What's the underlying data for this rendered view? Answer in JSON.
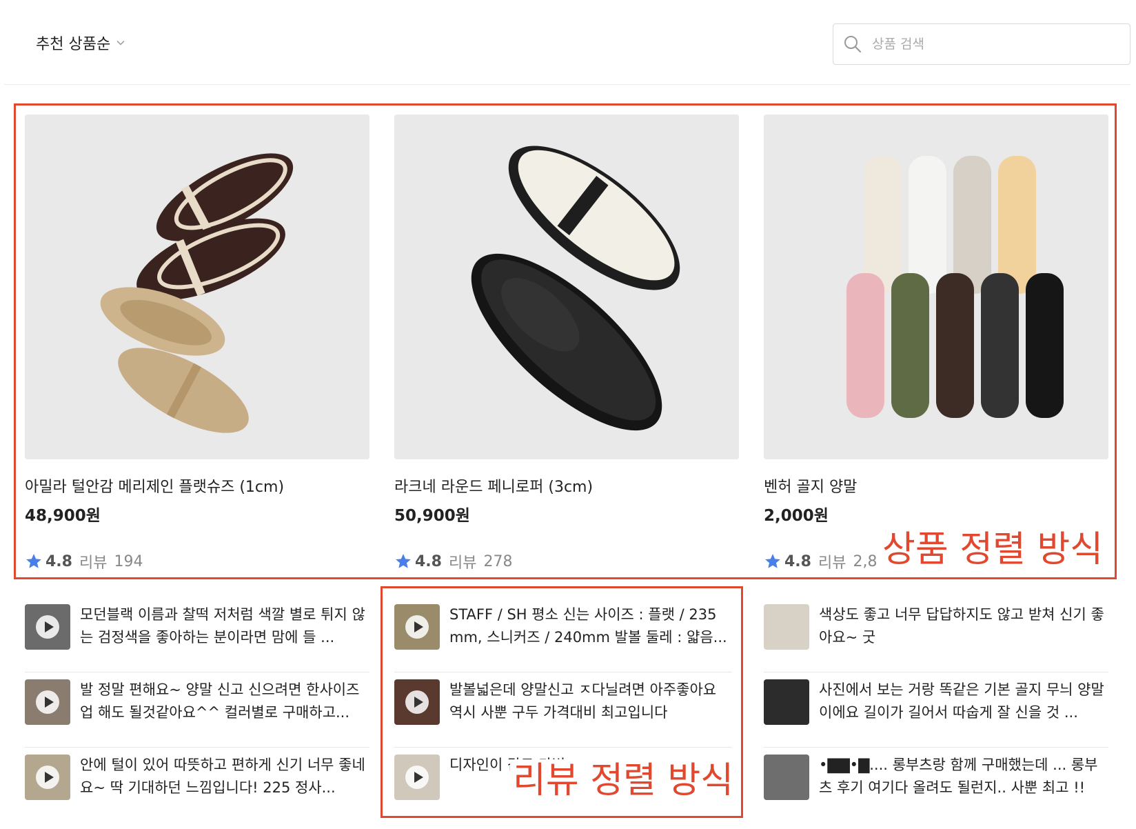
{
  "header": {
    "sort_label": "추천 상품순",
    "search_placeholder": "상품 검색"
  },
  "products": [
    {
      "name": "아밀라 털안감 메리제인 플랫슈즈 (1cm)",
      "price": "48,900원",
      "rating": "4.8",
      "review_label": "리뷰",
      "review_count": "194"
    },
    {
      "name": "라크네 라운드 페니로퍼 (3cm)",
      "price": "50,900원",
      "rating": "4.8",
      "review_label": "리뷰",
      "review_count": "278"
    },
    {
      "name": "벤허 골지 양말",
      "price": "2,000원",
      "rating": "4.8",
      "review_label": "리뷰",
      "review_count": "2,8"
    }
  ],
  "reviews": [
    [
      {
        "text": "모던블랙 이름과 찰떡 저처럼 색깔 별로 튀지 않는 검정색을 좋아하는 분이라면 맘에 들 ..."
      },
      {
        "text": "발 정말 편해요~ 양말 신고 신으려면 한사이즈 업 해도 될것같아요^^ 컬러별로 구매하고..."
      },
      {
        "text": "안에 털이 있어 따뜻하고 편하게 신기 너무 좋네요~ 딱 기대하던 느낌입니다! 225 정사..."
      }
    ],
    [
      {
        "text": "STAFF / SH 평소 신는 사이즈 : 플랫 / 235 mm, 스니커즈 / 240mm 발볼 둘레 : 얇음..."
      },
      {
        "text": "발볼넓은데 양말신고 ㅈ다닐려면 아주좋아요 역시 사뿐 구두 가격대비 최고입니다"
      },
      {
        "text": "디자인이 감도 가볍"
      }
    ],
    [
      {
        "text": "색상도 좋고 너무 답답하지도 않고 받쳐 신기 좋아요~ 굿"
      },
      {
        "text": "사진에서 보는 거랑 똑같은 기본 골지 무늬 양말이에요 길이가 길어서 따숩게 잘 신을 것 ..."
      },
      {
        "text": "•▇▇•▇.... 롱부츠랑 함께 구매했는데 ... 롱부츠 후기 여기다 올려도 될런지.. 사뿐 최고 !!"
      }
    ]
  ],
  "annotations": {
    "product_sort": "상품 정렬 방식",
    "review_sort": "리뷰 정렬 방식"
  },
  "colors": {
    "annotation": "#e0482f",
    "star": "#4a7ee8"
  }
}
